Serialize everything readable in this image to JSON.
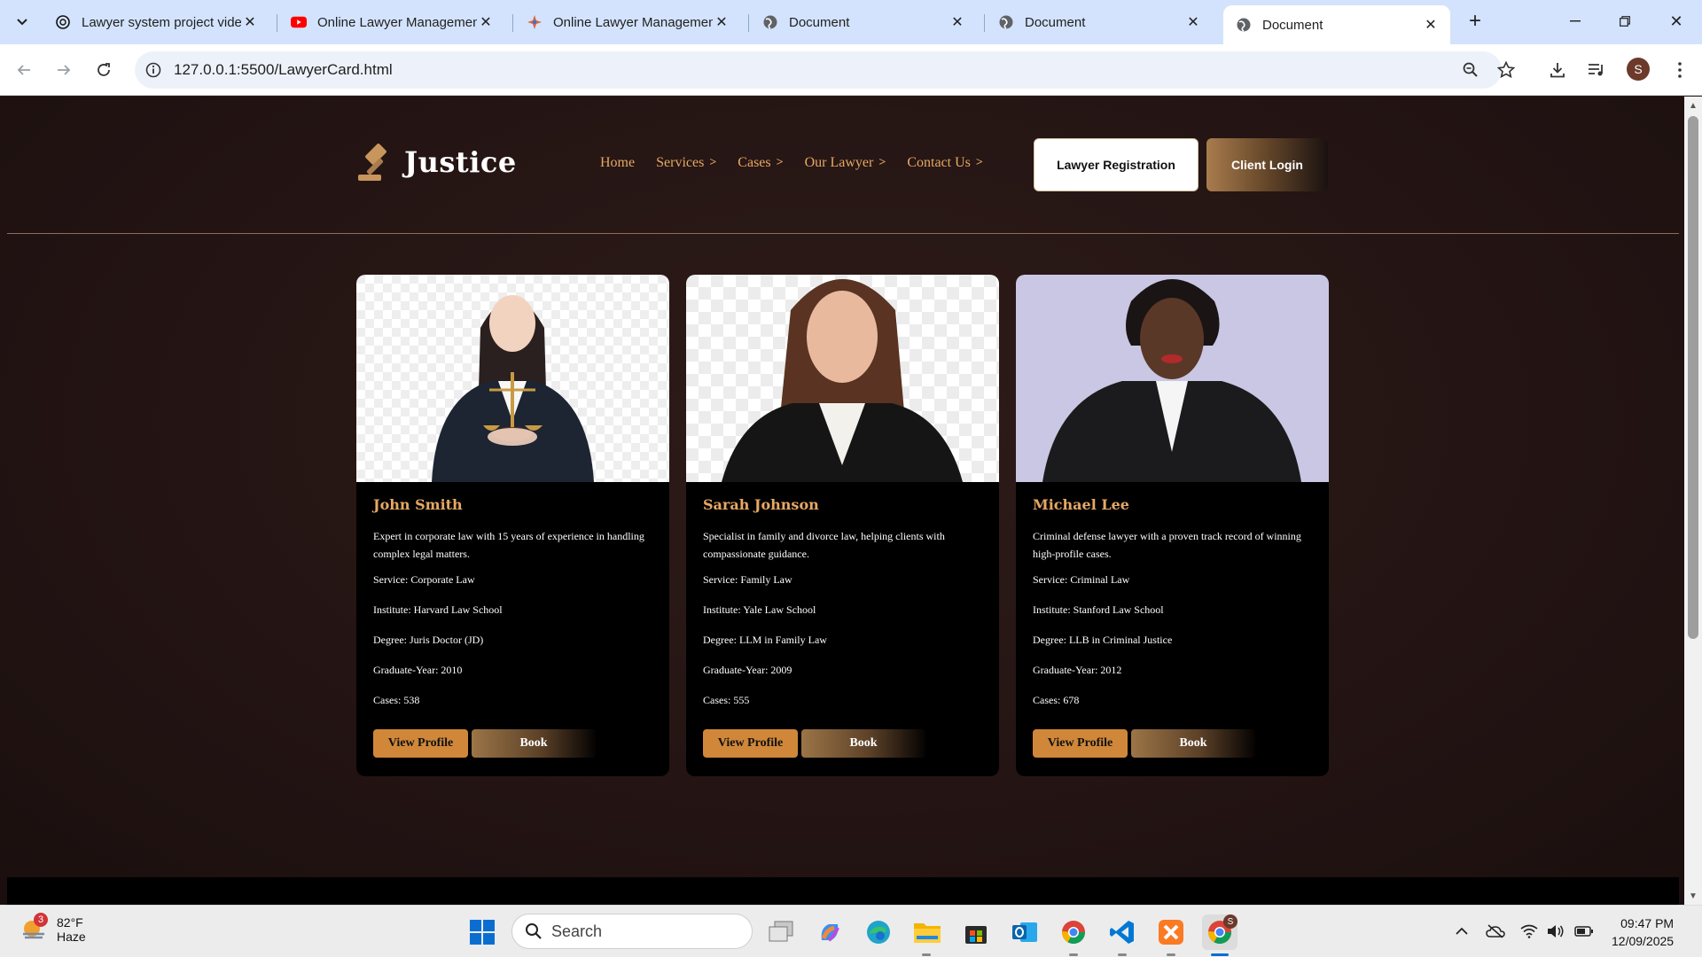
{
  "browser": {
    "tabs": [
      {
        "title": "Lawyer system project vide",
        "icon": "chatgpt-icon"
      },
      {
        "title": "Online Lawyer Managemen",
        "icon": "youtube-icon"
      },
      {
        "title": "Online Lawyer Managemen",
        "icon": "claude-icon"
      },
      {
        "title": "Document",
        "icon": "globe-icon"
      },
      {
        "title": "Document",
        "icon": "globe-icon"
      },
      {
        "title": "Document",
        "icon": "globe-icon"
      }
    ],
    "url": "127.0.0.1:5500/LawyerCard.html",
    "profile_initial": "S"
  },
  "site": {
    "brand": "Justice",
    "nav": [
      {
        "label": "Home",
        "chevron": false
      },
      {
        "label": "Services",
        "chevron": true
      },
      {
        "label": "Cases",
        "chevron": true
      },
      {
        "label": "Our Lawyer",
        "chevron": true
      },
      {
        "label": "Contact Us",
        "chevron": true
      }
    ],
    "register_label": "Lawyer Registration",
    "login_label": "Client Login",
    "accent": "#e7a864"
  },
  "lawyers": [
    {
      "name": "John Smith",
      "desc": "Expert in corporate law with 15 years of experience in handling complex legal matters.",
      "service": "Service: Corporate Law",
      "institute": "Institute: Harvard Law School",
      "degree": "Degree: Juris Doctor (JD)",
      "grad": "Graduate-Year: 2010",
      "cases": "Cases: 538",
      "view_label": "View Profile",
      "book_label": "Book"
    },
    {
      "name": "Sarah Johnson",
      "desc": "Specialist in family and divorce law, helping clients with compassionate guidance.",
      "service": "Service: Family Law",
      "institute": "Institute: Yale Law School",
      "degree": "Degree: LLM in Family Law",
      "grad": "Graduate-Year: 2009",
      "cases": "Cases: 555",
      "view_label": "View Profile",
      "book_label": "Book"
    },
    {
      "name": "Michael Lee",
      "desc": "Criminal defense lawyer with a proven track record of winning high-profile cases.",
      "service": "Service: Criminal Law",
      "institute": "Institute: Stanford Law School",
      "degree": "Degree: LLB in Criminal Justice",
      "grad": "Graduate-Year: 2012",
      "cases": "Cases: 678",
      "view_label": "View Profile",
      "book_label": "Book"
    }
  ],
  "taskbar": {
    "weather_temp": "82°F",
    "weather_cond": "Haze",
    "weather_badge": "3",
    "search_placeholder": "Search",
    "chrome_badge": "S",
    "time": "09:47 PM",
    "date": "12/09/2025"
  }
}
